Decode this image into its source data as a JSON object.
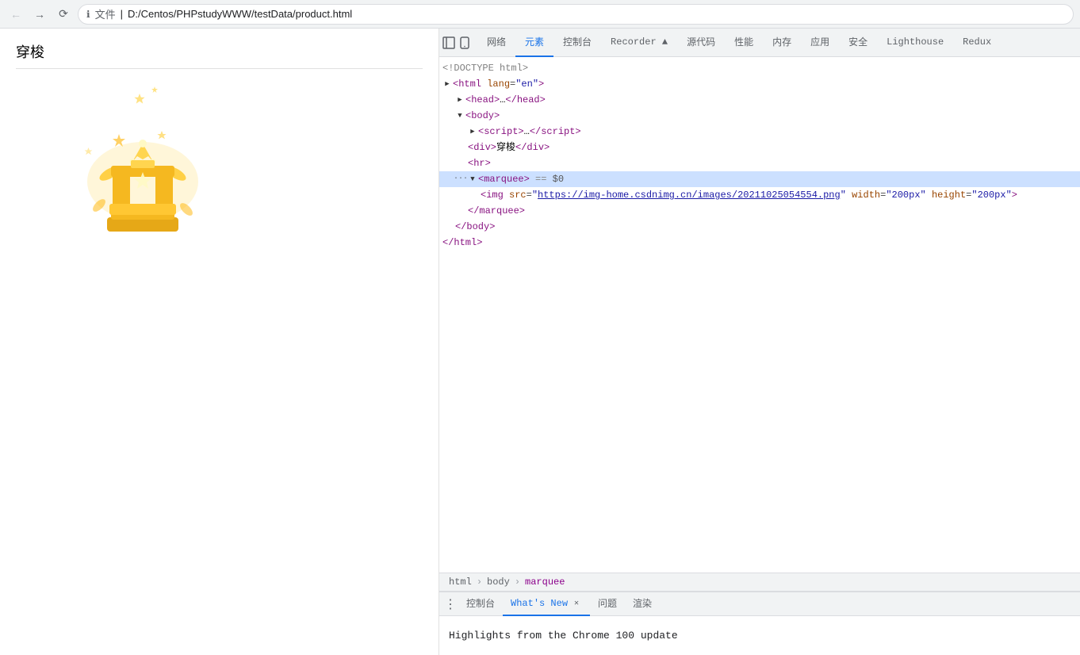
{
  "browser": {
    "url_file_label": "文件",
    "url_path": "D:/Centos/PHPstudyWWW/testData/product.html",
    "info_icon": "ℹ"
  },
  "devtools": {
    "tabs": [
      {
        "label": "网络",
        "active": false,
        "icon": ""
      },
      {
        "label": "元素",
        "active": true,
        "icon": ""
      },
      {
        "label": "控制台",
        "active": false,
        "icon": ""
      },
      {
        "label": "Recorder ▲",
        "active": false,
        "icon": ""
      },
      {
        "label": "源代码",
        "active": false,
        "icon": ""
      },
      {
        "label": "性能",
        "active": false,
        "icon": ""
      },
      {
        "label": "内存",
        "active": false,
        "icon": ""
      },
      {
        "label": "应用",
        "active": false,
        "icon": ""
      },
      {
        "label": "安全",
        "active": false,
        "icon": ""
      },
      {
        "label": "Lighthouse",
        "active": false,
        "icon": ""
      },
      {
        "label": "Redux",
        "active": false,
        "icon": ""
      }
    ],
    "top_icons": [
      "inspect",
      "device"
    ],
    "dom": {
      "lines": [
        {
          "indent": 0,
          "dots": false,
          "triangle": "",
          "content_html": "<span class='c-comment'>&lt;!DOCTYPE html&gt;</span>"
        },
        {
          "indent": 0,
          "dots": false,
          "triangle": "▶",
          "content_html": "<span class='c-tag'>&lt;html</span> <span class='c-attr'>lang</span><span class='c-eq'>=</span><span class='c-val'>\"en\"</span><span class='c-tag'>&gt;</span>"
        },
        {
          "indent": 1,
          "dots": false,
          "triangle": "▶",
          "content_html": "<span class='c-tag'>&lt;head&gt;</span><span class='c-text'>…</span><span class='c-tag'>&lt;/head&gt;</span>"
        },
        {
          "indent": 1,
          "dots": false,
          "triangle": "▼",
          "content_html": "<span class='c-tag'>&lt;body&gt;</span>"
        },
        {
          "indent": 2,
          "dots": false,
          "triangle": "▶",
          "content_html": "<span class='c-tag'>&lt;script&gt;</span><span class='c-text'>…</span><span class='c-tag'>&lt;/script&gt;</span>"
        },
        {
          "indent": 2,
          "dots": false,
          "triangle": "",
          "content_html": "<span class='c-tag'>&lt;div&gt;</span><span class='c-text'>穿梭</span><span class='c-tag'>&lt;/div&gt;</span>"
        },
        {
          "indent": 2,
          "dots": false,
          "triangle": "",
          "content_html": "<span class='c-tag'>&lt;hr&gt;</span>"
        },
        {
          "indent": 2,
          "dots": true,
          "triangle": "▼",
          "content_html": "<span class='c-tag'>&lt;marquee&gt;</span> <span class='c-eq'>== $0</span>",
          "selected": true
        },
        {
          "indent": 3,
          "dots": false,
          "triangle": "",
          "content_html": "<span class='c-tag'>&lt;img</span> <span class='c-attr'>src</span><span class='c-eq'>=</span><span class='c-val'>\"https://img-home.csdnimg.cn/images/20211025054554.png\"</span> <span class='c-attr'>width</span><span class='c-eq'>=</span><span class='c-val'>\"200px\"</span> <span class='c-attr'>height</span><span class='c-eq'>=</span><span class='c-val'>\"200px\"</span><span class='c-tag'>&gt;</span>"
        },
        {
          "indent": 2,
          "dots": false,
          "triangle": "",
          "content_html": "<span class='c-tag'>&lt;/marquee&gt;</span>"
        },
        {
          "indent": 1,
          "dots": false,
          "triangle": "",
          "content_html": "<span class='c-tag'>&lt;/body&gt;</span>"
        },
        {
          "indent": 0,
          "dots": false,
          "triangle": "",
          "content_html": "<span class='c-tag'>&lt;/html&gt;</span>"
        }
      ]
    },
    "breadcrumb": {
      "items": [
        {
          "label": "html",
          "active": false
        },
        {
          "label": "body",
          "active": false
        },
        {
          "label": "marquee",
          "active": true
        }
      ]
    },
    "bottom_tabs": [
      {
        "label": "控制台",
        "active": false,
        "closable": false
      },
      {
        "label": "What's New",
        "active": true,
        "closable": true
      },
      {
        "label": "问题",
        "active": false,
        "closable": false
      },
      {
        "label": "渲染",
        "active": false,
        "closable": false
      }
    ],
    "bottom_content": "Highlights from the Chrome 100 update"
  },
  "page": {
    "title": "穿梭"
  }
}
